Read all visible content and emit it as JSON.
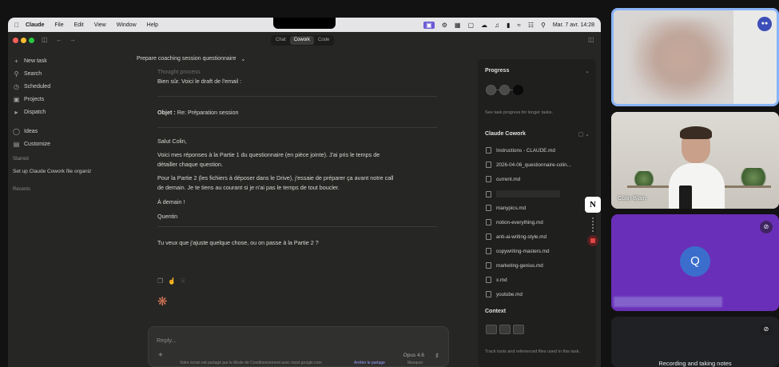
{
  "menubar": {
    "app": "Claude",
    "items": [
      "File",
      "Edit",
      "View",
      "Window",
      "Help"
    ],
    "clock": "Mar. 7 avr. 14:28"
  },
  "window": {
    "tabs": [
      "Chat",
      "Cowork",
      "Code"
    ],
    "active_tab": "Cowork"
  },
  "sidebar": {
    "new_task": "New task",
    "search": "Search",
    "scheduled": "Scheduled",
    "projects": "Projects",
    "dispatch": "Dispatch",
    "ideas": "Ideas",
    "customize": "Customize",
    "starred_heading": "Starred",
    "starred_item": "Set up Claude Cowork file organiz",
    "recents_heading": "Recents"
  },
  "conversation": {
    "title": "Prepare coaching session questionnaire",
    "thought": "Thought process",
    "intro": "Bien sûr. Voici le draft de l'email :",
    "subject_label": "Objet :",
    "subject_value": "Re: Préparation session",
    "greeting": "Salut Colin,",
    "para1_l1": "Voici mes réponses à la Partie 1 du questionnaire (en pièce jointe). J'ai pris le temps de",
    "para1_l2": "détailler chaque question.",
    "para2_l1": "Pour la Partie 2 (les fichiers à déposer dans le Drive), j'essaie de préparer ça avant notre call",
    "para2_l2": "de demain. Je te tiens au courant si je n'ai pas le temps de tout boucler.",
    "closing": "À demain !",
    "signature": "Quentin",
    "followup": "Tu veux que j'ajuste quelque chose, ou on passe à la Partie 2 ?"
  },
  "input": {
    "placeholder": "Reply...",
    "model": "Opus 4.6"
  },
  "right_panel": {
    "progress_title": "Progress",
    "progress_hint": "See task progress for longer tasks.",
    "cowork_title": "Claude Cowork",
    "files": [
      "Instructions - CLAUDE.md",
      "2026-04-06_questionnaire-colin...",
      "current.md",
      "",
      "manypics.md",
      "notion-everything.md",
      "anti-ai-writing-style.md",
      "copywriting-masters.md",
      "marketing-genius.md",
      "x.md",
      "youtube.md"
    ],
    "context_title": "Context",
    "context_hint": "Track tools and referenced files used in this task."
  },
  "bottom_banner": {
    "text": "Votre écran est partagé par le Mode de Conditionnement avec meet.google.com",
    "stop": "Arrêter le partage",
    "hide": "Masquer"
  },
  "meet": {
    "participant2_name": "Colin Blain",
    "participant3_initial": "Q",
    "status": "Recording and taking notes"
  }
}
